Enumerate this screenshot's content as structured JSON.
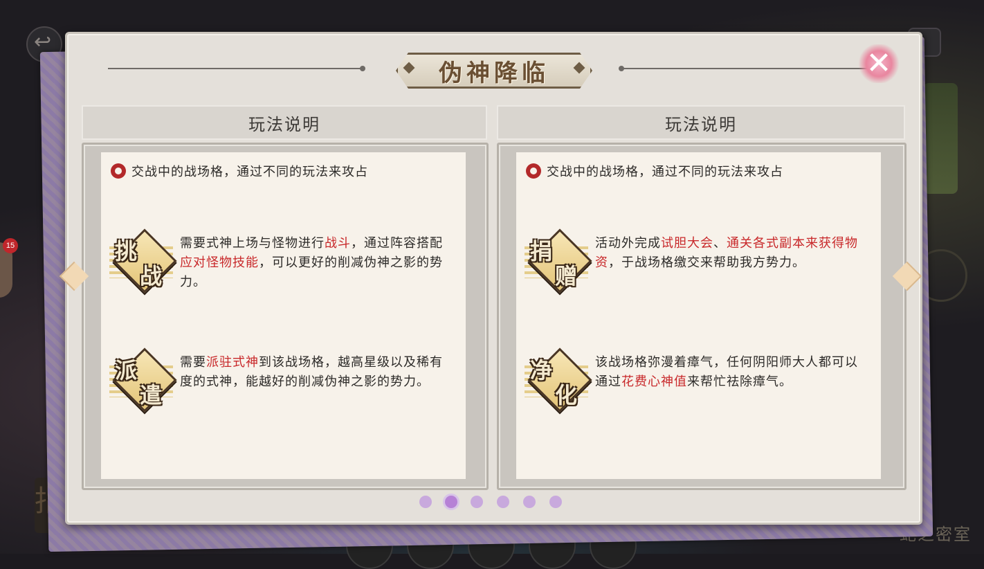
{
  "panel": {
    "title_chars": [
      "伪神降临"
    ],
    "close_icon": "close-icon"
  },
  "background": {
    "badge_count": "15",
    "footer_label": "蛇之密室",
    "corner_char": "指"
  },
  "columns": [
    {
      "header": "玩法说明",
      "intro": "交战中的战场格，通过不同的玩法来攻占",
      "entries": [
        {
          "icon_chars": [
            "挑",
            "战"
          ],
          "text_parts": [
            "需要式神上场与怪物进行",
            "战斗",
            "，通过阵容搭配",
            "应对怪物技能",
            "，可以更好的削减伪神之影的势力。"
          ]
        },
        {
          "icon_chars": [
            "派",
            "遣"
          ],
          "text_parts": [
            "需要",
            "派驻式神",
            "到该战场格，越高星级以及稀有度的式神，能越好的削减伪神之影的势力。"
          ]
        }
      ]
    },
    {
      "header": "玩法说明",
      "intro": "交战中的战场格，通过不同的玩法来攻占",
      "entries": [
        {
          "icon_chars": [
            "捐",
            "赠"
          ],
          "text_parts": [
            "活动外完成",
            "试胆大会",
            "、",
            "通关各式副本来获得物资",
            "，于战场格缴交来帮助我方势力。"
          ]
        },
        {
          "icon_chars": [
            "净",
            "化"
          ],
          "text_parts": [
            "该战场格弥漫着瘴气，任何阴阳师大人都可以通过",
            "花费心神值",
            "来帮忙祛除瘴气。"
          ]
        }
      ]
    }
  ],
  "pagination": {
    "total": 6,
    "active_index": 1
  },
  "colors": {
    "highlight": "#c8282a",
    "panel_bg": "#e4e0da",
    "paper_bg": "#f7f2ea",
    "dot": "#c8a9dd",
    "dot_active": "#b681d6"
  }
}
